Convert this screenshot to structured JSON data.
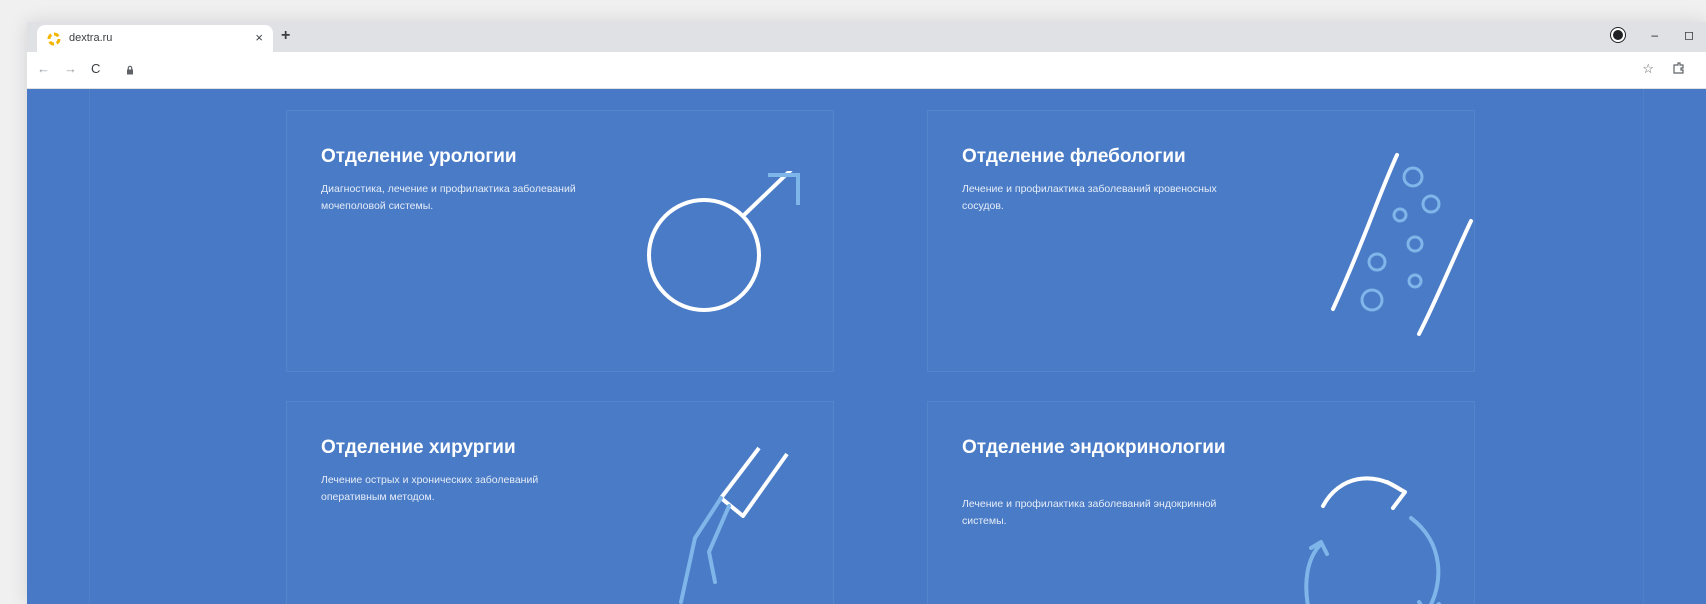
{
  "browser": {
    "tab": {
      "title": "dextra.ru",
      "close_label": "×"
    },
    "new_tab_label": "+",
    "window_controls": {
      "minimize": "–",
      "maximize": "◻"
    },
    "toolbar": {
      "back": "←",
      "forward": "→",
      "reload": "C",
      "star": "☆"
    }
  },
  "colors": {
    "page_background": "#4779c6",
    "icon_white": "#ffffff",
    "icon_accent": "#7fb6ea",
    "favicon": "#f4b400"
  },
  "icons": {
    "favicon": "orange-ring-logo",
    "card1": "male-symbol-icon",
    "card2": "blood-vessel-icon",
    "card3": "scalpel-icon",
    "card4": "cycle-arrows-icon"
  },
  "cards": [
    {
      "title": "Отделение урологии",
      "description": "Диагностика, лечение и профилактика заболеваний мочеполовой системы."
    },
    {
      "title": "Отделение флебологии",
      "description": "Лечение и профилактика заболеваний кровеносных сосудов."
    },
    {
      "title": "Отделение хирургии",
      "description": "Лечение острых и хронических заболеваний оперативным методом."
    },
    {
      "title": "Отделение эндокринологии",
      "description": "Лечение и профилактика заболеваний эндокринной системы."
    }
  ]
}
